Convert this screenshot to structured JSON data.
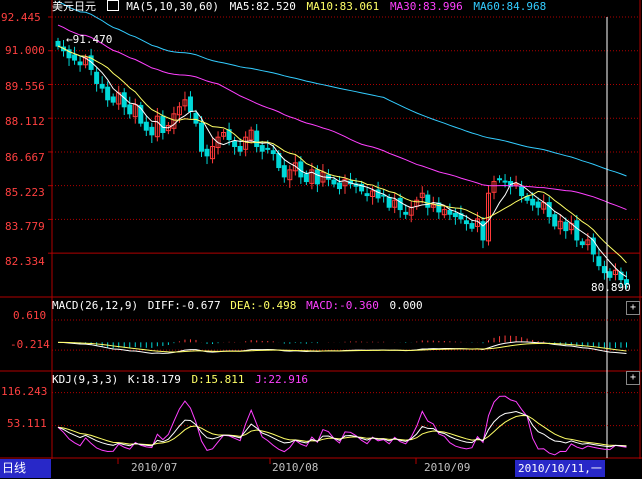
{
  "main_panel": {
    "title": "美元日元",
    "ma_indicator": "MA(5,10,30,60)",
    "ma5": "MA5:82.520",
    "ma10": "MA10:83.061",
    "ma30": "MA30:83.996",
    "ma60": "MA60:84.968",
    "y_ticks": [
      "92.445",
      "91.000",
      "89.556",
      "88.112",
      "86.667",
      "85.223",
      "83.779",
      "82.334"
    ],
    "high_label": "91.470",
    "low_label": "80.890"
  },
  "macd_panel": {
    "indicator": "MACD(26,12,9)",
    "diff": "DIFF:-0.677",
    "dea": "DEA:-0.498",
    "macd": "MACD:-0.360",
    "zero": "0.000",
    "y_ticks": [
      "0.610",
      "-0.214"
    ]
  },
  "kdj_panel": {
    "indicator": "KDJ(9,3,3)",
    "k": "K:18.179",
    "d": "D:15.811",
    "j": "J:22.916",
    "y_ticks": [
      "116.243",
      "53.111"
    ]
  },
  "x_axis": {
    "period": "日线",
    "months": [
      "2010/07",
      "2010/08",
      "2010/09"
    ],
    "cursor_date": "2010/10/11,一"
  },
  "expand_button": "+",
  "colors": {
    "up": "#ff3a3a",
    "down": "#00d8d8",
    "ma5": "#ffffff",
    "ma10": "#ffff66",
    "ma30": "#ff40ff",
    "ma60": "#33ccff",
    "grid": "#b00000"
  },
  "chart_data": [
    {
      "type": "candlestick",
      "name": "main",
      "ylim": [
        80.5,
        92.445
      ],
      "closes": [
        91.2,
        91.0,
        90.7,
        90.6,
        90.4,
        90.7,
        90.2,
        89.6,
        89.4,
        88.9,
        88.8,
        89.2,
        88.6,
        88.3,
        88.7,
        87.9,
        87.6,
        87.4,
        88.2,
        87.5,
        87.8,
        88.3,
        88.6,
        88.9,
        88.4,
        87.9,
        86.7,
        86.5,
        86.9,
        87.3,
        87.5,
        87.2,
        86.9,
        86.7,
        87.3,
        87.6,
        86.9,
        86.7,
        86.8,
        86.6,
        86.0,
        85.6,
        85.9,
        86.2,
        85.6,
        85.4,
        85.9,
        85.3,
        85.8,
        85.5,
        85.3,
        85.1,
        85.5,
        85.3,
        85.2,
        85.0,
        84.8,
        85.0,
        84.7,
        84.8,
        84.3,
        84.6,
        84.2,
        84.0,
        84.3,
        84.6,
        84.9,
        84.3,
        84.4,
        84.1,
        84.2,
        84.0,
        83.9,
        83.8,
        83.6,
        83.4,
        83.8,
        82.9,
        84.9,
        85.4,
        85.5,
        85.4,
        85.2,
        85.3,
        84.8,
        84.6,
        84.4,
        84.3,
        84.5,
        83.9,
        83.5,
        83.7,
        83.3,
        83.6,
        82.9,
        82.7,
        82.9,
        82.3,
        81.8,
        81.5,
        81.3,
        81.6,
        81.2,
        81.0
      ]
    },
    {
      "type": "macd",
      "name": "MACD(26,12,9)",
      "ylim": [
        -0.7,
        0.8
      ]
    },
    {
      "type": "kdj",
      "name": "KDJ(9,3,3)",
      "ylim": [
        -5,
        125
      ]
    }
  ]
}
